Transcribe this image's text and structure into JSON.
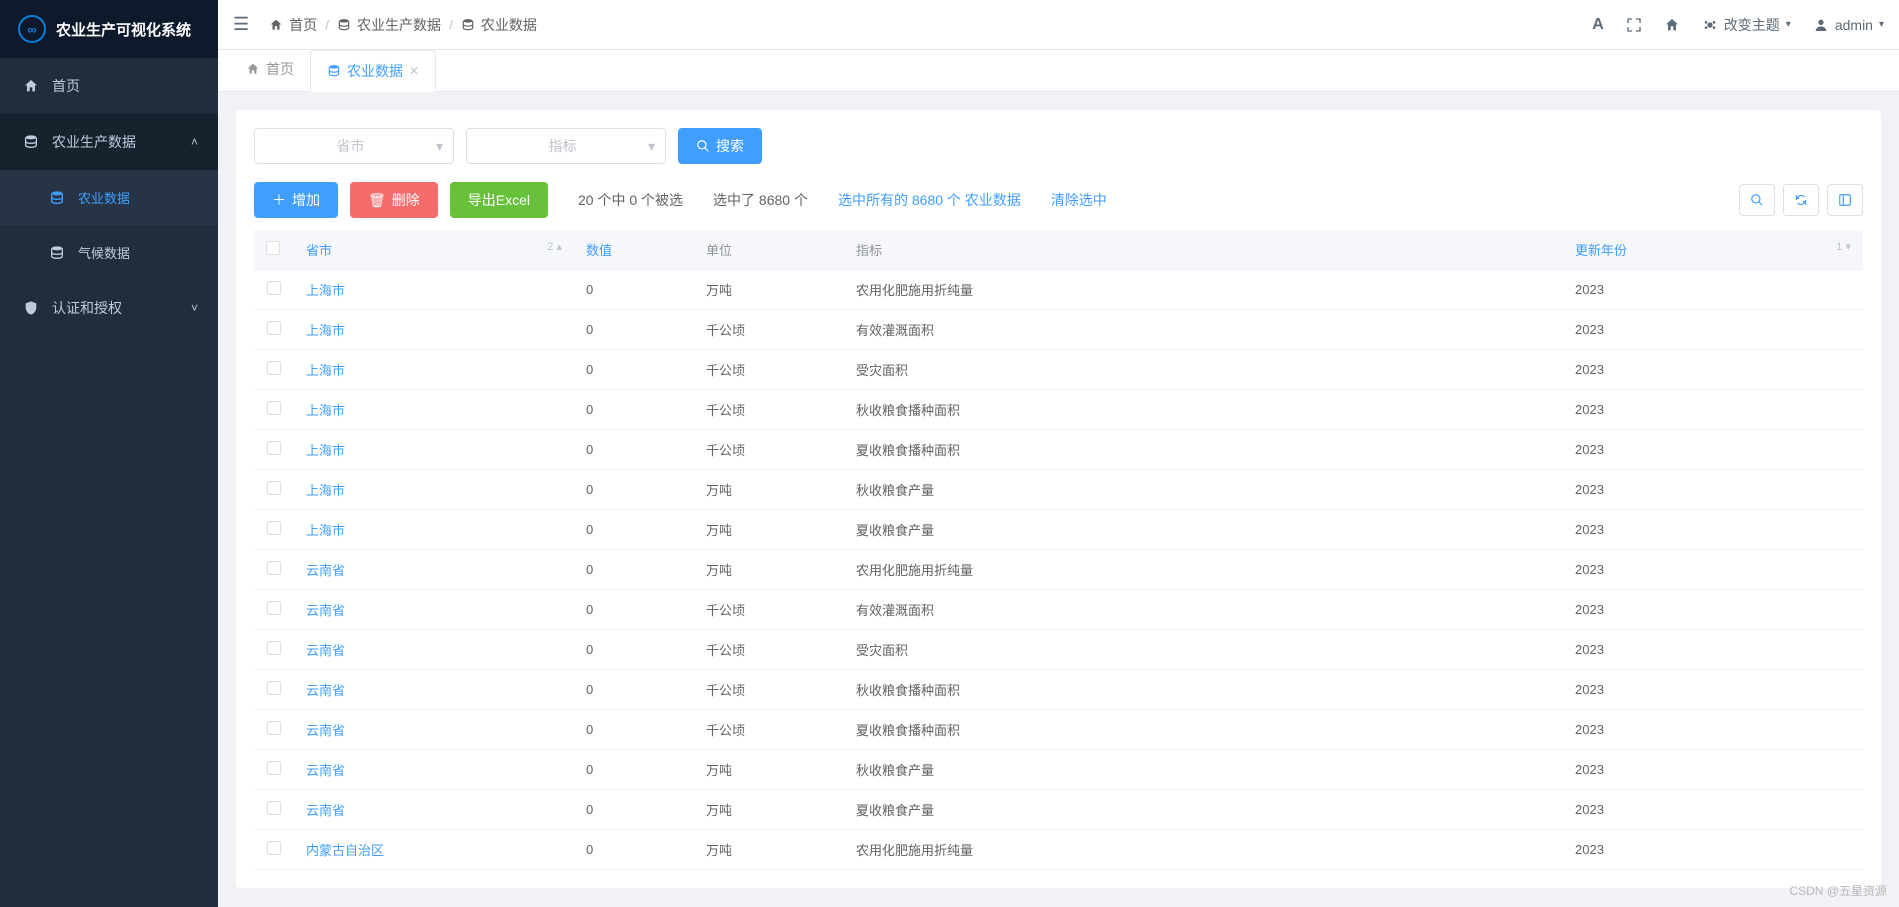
{
  "app_title": "农业生产可视化系统",
  "sidebar": {
    "items": [
      {
        "label": "首页",
        "icon": "home",
        "active": false
      },
      {
        "label": "农业生产数据",
        "icon": "database",
        "expandable": true,
        "expanded": true
      },
      {
        "label": "农业数据",
        "icon": "database",
        "sub": true,
        "active": true
      },
      {
        "label": "气候数据",
        "icon": "database",
        "sub": true
      },
      {
        "label": "认证和授权",
        "icon": "shield",
        "expandable": true,
        "expanded": false
      }
    ]
  },
  "topbar": {
    "breadcrumb": [
      {
        "label": "首页",
        "icon": "home"
      },
      {
        "label": "农业生产数据",
        "icon": "database"
      },
      {
        "label": "农业数据",
        "icon": "database"
      }
    ],
    "theme_label": "改变主题",
    "user_label": "admin"
  },
  "tabs": [
    {
      "label": "首页",
      "icon": "home",
      "active": false,
      "closable": false
    },
    {
      "label": "农业数据",
      "icon": "database",
      "active": true,
      "closable": true
    }
  ],
  "filters": {
    "province_placeholder": "省市",
    "indicator_placeholder": "指标",
    "search_label": "搜索"
  },
  "actions": {
    "add_label": "增加",
    "delete_label": "删除",
    "export_label": "导出Excel",
    "selection_summary": "20 个中 0 个被选",
    "total_selected": "选中了 8680 个",
    "select_all_link": "选中所有的 8680 个 农业数据",
    "clear_selection": "清除选中"
  },
  "table": {
    "headers": {
      "province": "省市",
      "province_sort": "2",
      "value": "数值",
      "unit": "单位",
      "indicator": "指标",
      "year": "更新年份",
      "year_sort": "1"
    },
    "rows": [
      {
        "province": "上海市",
        "value": "0",
        "unit": "万吨",
        "indicator": "农用化肥施用折纯量",
        "year": "2023"
      },
      {
        "province": "上海市",
        "value": "0",
        "unit": "千公顷",
        "indicator": "有效灌溉面积",
        "year": "2023"
      },
      {
        "province": "上海市",
        "value": "0",
        "unit": "千公顷",
        "indicator": "受灾面积",
        "year": "2023"
      },
      {
        "province": "上海市",
        "value": "0",
        "unit": "千公顷",
        "indicator": "秋收粮食播种面积",
        "year": "2023"
      },
      {
        "province": "上海市",
        "value": "0",
        "unit": "千公顷",
        "indicator": "夏收粮食播种面积",
        "year": "2023"
      },
      {
        "province": "上海市",
        "value": "0",
        "unit": "万吨",
        "indicator": "秋收粮食产量",
        "year": "2023"
      },
      {
        "province": "上海市",
        "value": "0",
        "unit": "万吨",
        "indicator": "夏收粮食产量",
        "year": "2023"
      },
      {
        "province": "云南省",
        "value": "0",
        "unit": "万吨",
        "indicator": "农用化肥施用折纯量",
        "year": "2023"
      },
      {
        "province": "云南省",
        "value": "0",
        "unit": "千公顷",
        "indicator": "有效灌溉面积",
        "year": "2023"
      },
      {
        "province": "云南省",
        "value": "0",
        "unit": "千公顷",
        "indicator": "受灾面积",
        "year": "2023"
      },
      {
        "province": "云南省",
        "value": "0",
        "unit": "千公顷",
        "indicator": "秋收粮食播种面积",
        "year": "2023"
      },
      {
        "province": "云南省",
        "value": "0",
        "unit": "千公顷",
        "indicator": "夏收粮食播种面积",
        "year": "2023"
      },
      {
        "province": "云南省",
        "value": "0",
        "unit": "万吨",
        "indicator": "秋收粮食产量",
        "year": "2023"
      },
      {
        "province": "云南省",
        "value": "0",
        "unit": "万吨",
        "indicator": "夏收粮食产量",
        "year": "2023"
      },
      {
        "province": "内蒙古自治区",
        "value": "0",
        "unit": "万吨",
        "indicator": "农用化肥施用折纯量",
        "year": "2023"
      }
    ]
  },
  "watermark": "CSDN @五星资源"
}
